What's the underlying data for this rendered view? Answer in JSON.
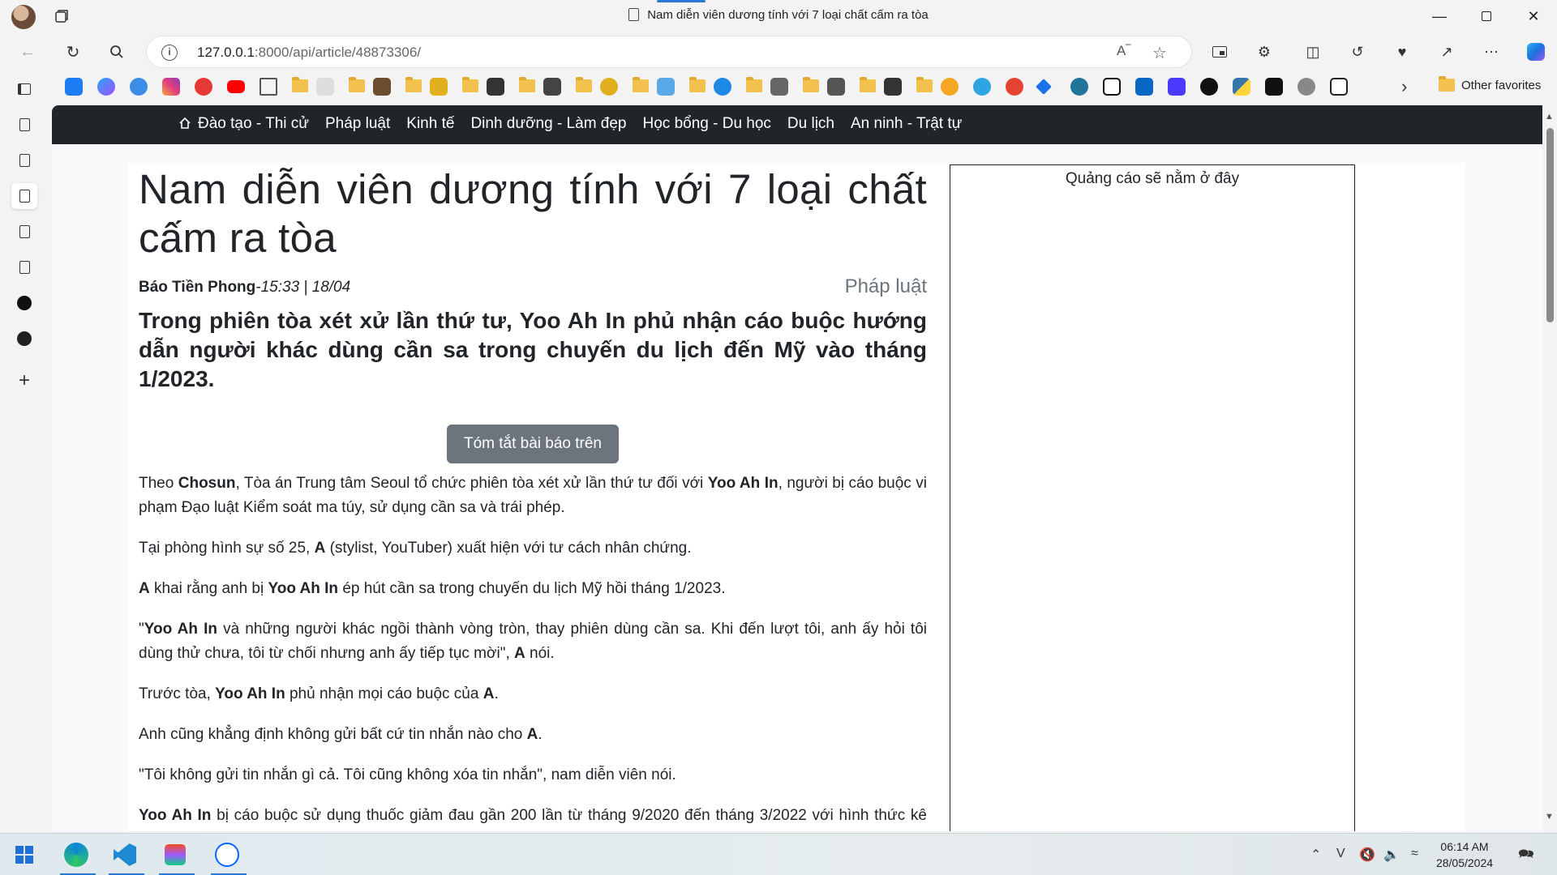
{
  "window": {
    "tab_title": "Nam diễn viên dương tính với 7 loại chất cấm ra tòa"
  },
  "address_bar": {
    "url_host": "127.0.0.1",
    "url_rest": ":8000/api/article/48873306/"
  },
  "favorites": {
    "other_label": "Other favorites"
  },
  "site_nav": {
    "items": [
      "Đào tạo - Thi cử",
      "Pháp luật",
      "Kinh tế",
      "Dinh dưỡng - Làm đẹp",
      "Học bổng - Du học",
      "Du lịch",
      "An ninh - Trật tự"
    ]
  },
  "article": {
    "title": "Nam diễn viên dương tính với 7 loại chất cấm ra tòa",
    "source": "Báo Tiền Phong",
    "time": "-15:33 | 18/04",
    "category": "Pháp luật",
    "lead": "Trong phiên tòa xét xử lần thứ tư, Yoo Ah In phủ nhận cáo buộc hướng dẫn người khác dùng cần sa trong chuyến du lịch đến Mỹ vào tháng 1/2023.",
    "summarize_button": "Tóm tắt bài báo trên",
    "paragraphs": [
      {
        "segments": [
          {
            "t": "Theo "
          },
          {
            "t": "Chosun",
            "b": true
          },
          {
            "t": ", Tòa án Trung tâm Seoul tổ chức phiên tòa xét xử lần thứ tư đối với "
          },
          {
            "t": "Yoo Ah In",
            "b": true
          },
          {
            "t": ", người bị cáo buộc vi phạm Đạo luật Kiểm soát ma túy, sử dụng cần sa và trái phép."
          }
        ]
      },
      {
        "segments": [
          {
            "t": "Tại phòng hình sự số 25, "
          },
          {
            "t": "A",
            "b": true
          },
          {
            "t": " (stylist, YouTuber) xuất hiện với tư cách nhân chứng."
          }
        ]
      },
      {
        "segments": [
          {
            "t": "A",
            "b": true
          },
          {
            "t": " khai rằng anh bị "
          },
          {
            "t": "Yoo Ah In",
            "b": true
          },
          {
            "t": " ép hút cần sa trong chuyến du lịch Mỹ hồi tháng 1/2023."
          }
        ]
      },
      {
        "segments": [
          {
            "t": "\""
          },
          {
            "t": "Yoo Ah In",
            "b": true
          },
          {
            "t": " và những người khác ngồi thành vòng tròn, thay phiên dùng cần sa. Khi đến lượt tôi, anh ấy hỏi tôi dùng thử chưa, tôi từ chối nhưng anh ấy tiếp tục mời\", "
          },
          {
            "t": "A",
            "b": true
          },
          {
            "t": " nói."
          }
        ]
      },
      {
        "segments": [
          {
            "t": "Trước tòa, "
          },
          {
            "t": "Yoo Ah In",
            "b": true
          },
          {
            "t": " phủ nhận mọi cáo buộc của "
          },
          {
            "t": "A",
            "b": true
          },
          {
            "t": "."
          }
        ]
      },
      {
        "segments": [
          {
            "t": "Anh cũng khẳng định không gửi bất cứ tin nhắn nào cho "
          },
          {
            "t": "A",
            "b": true
          },
          {
            "t": "."
          }
        ]
      },
      {
        "segments": [
          {
            "t": "\"Tôi không gửi tin nhắn gì cả. Tôi cũng không xóa tin nhắn\", nam diễn viên nói."
          }
        ]
      },
      {
        "segments": [
          {
            "t": "Yoo Ah In",
            "b": true
          },
          {
            "t": " bị cáo buộc sử dụng thuốc giảm đau gần 200 lần từ tháng 9/2020 đến tháng 3/2022 với hình thức kê đơn."
          }
        ]
      }
    ]
  },
  "ad": {
    "text": "Quảng cáo sẽ nằm ở đây"
  },
  "taskbar": {
    "time": "06:14 AM",
    "date": "28/05/2024"
  },
  "colors": {
    "nav_bg": "#212529",
    "button_gray": "#6c757d",
    "accent": "#2b78d4"
  }
}
